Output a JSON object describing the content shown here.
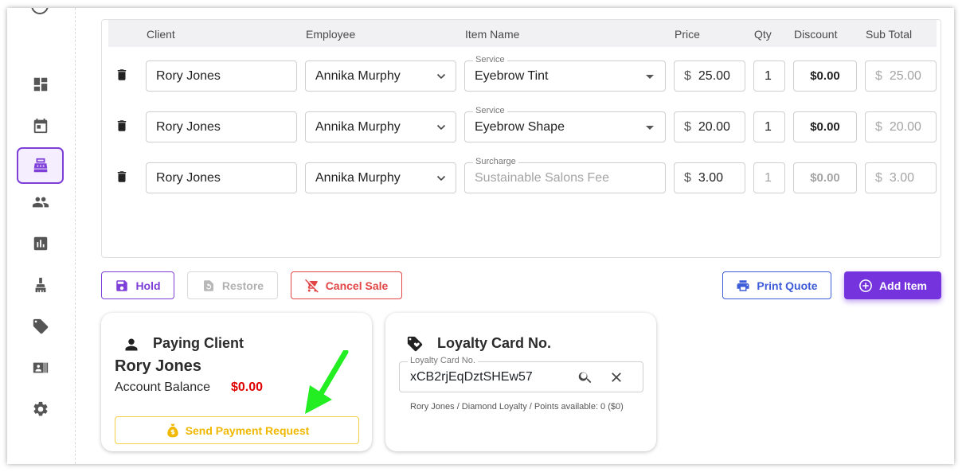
{
  "table": {
    "headers": {
      "client": "Client",
      "employee": "Employee",
      "item_name": "Item Name",
      "price": "Price",
      "qty": "Qty",
      "discount": "Discount",
      "sub_total": "Sub Total"
    },
    "rows": [
      {
        "client": "Rory Jones",
        "employee": "Annika Murphy",
        "item_label": "Service",
        "item": "Eyebrow Tint",
        "currency": "$",
        "price": "25.00",
        "qty": "1",
        "discount": "$0.00",
        "sub_total": "25.00"
      },
      {
        "client": "Rory Jones",
        "employee": "Annika Murphy",
        "item_label": "Service",
        "item": "Eyebrow Shape",
        "currency": "$",
        "price": "20.00",
        "qty": "1",
        "discount": "$0.00",
        "sub_total": "20.00"
      },
      {
        "client": "Rory Jones",
        "employee": "Annika Murphy",
        "item_label": "Surcharge",
        "item": "Sustainable Salons Fee",
        "currency": "$",
        "price": "3.00",
        "qty": "1",
        "discount": "$0.00",
        "sub_total": "3.00"
      }
    ]
  },
  "actions": {
    "hold": "Hold",
    "restore": "Restore",
    "cancel_sale": "Cancel Sale",
    "print_quote": "Print Quote",
    "add_item": "Add Item"
  },
  "paying_client": {
    "title": "Paying Client",
    "name": "Rory Jones",
    "balance_label": "Account Balance",
    "balance_value": "$0.00",
    "send_payment": "Send Payment Request"
  },
  "loyalty": {
    "title": "Loyalty Card No.",
    "field_label": "Loyalty Card No.",
    "card_number": "xCB2rjEqDztSHEw57",
    "info": "Rory Jones / Diamond Loyalty / Points available: 0 ($0)"
  },
  "sidebar": {
    "items": [
      "dashboard-icon",
      "calendar-icon",
      "register-icon",
      "clients-icon",
      "reports-icon",
      "products-icon",
      "tag-icon",
      "contact-card-icon",
      "settings-icon"
    ],
    "active": "register-icon"
  },
  "colors": {
    "accent": "#7433dd",
    "danger": "#e24545",
    "primary_blue": "#3e5bd8",
    "warning": "#f0b800",
    "annotation_arrow": "#22ee22"
  }
}
